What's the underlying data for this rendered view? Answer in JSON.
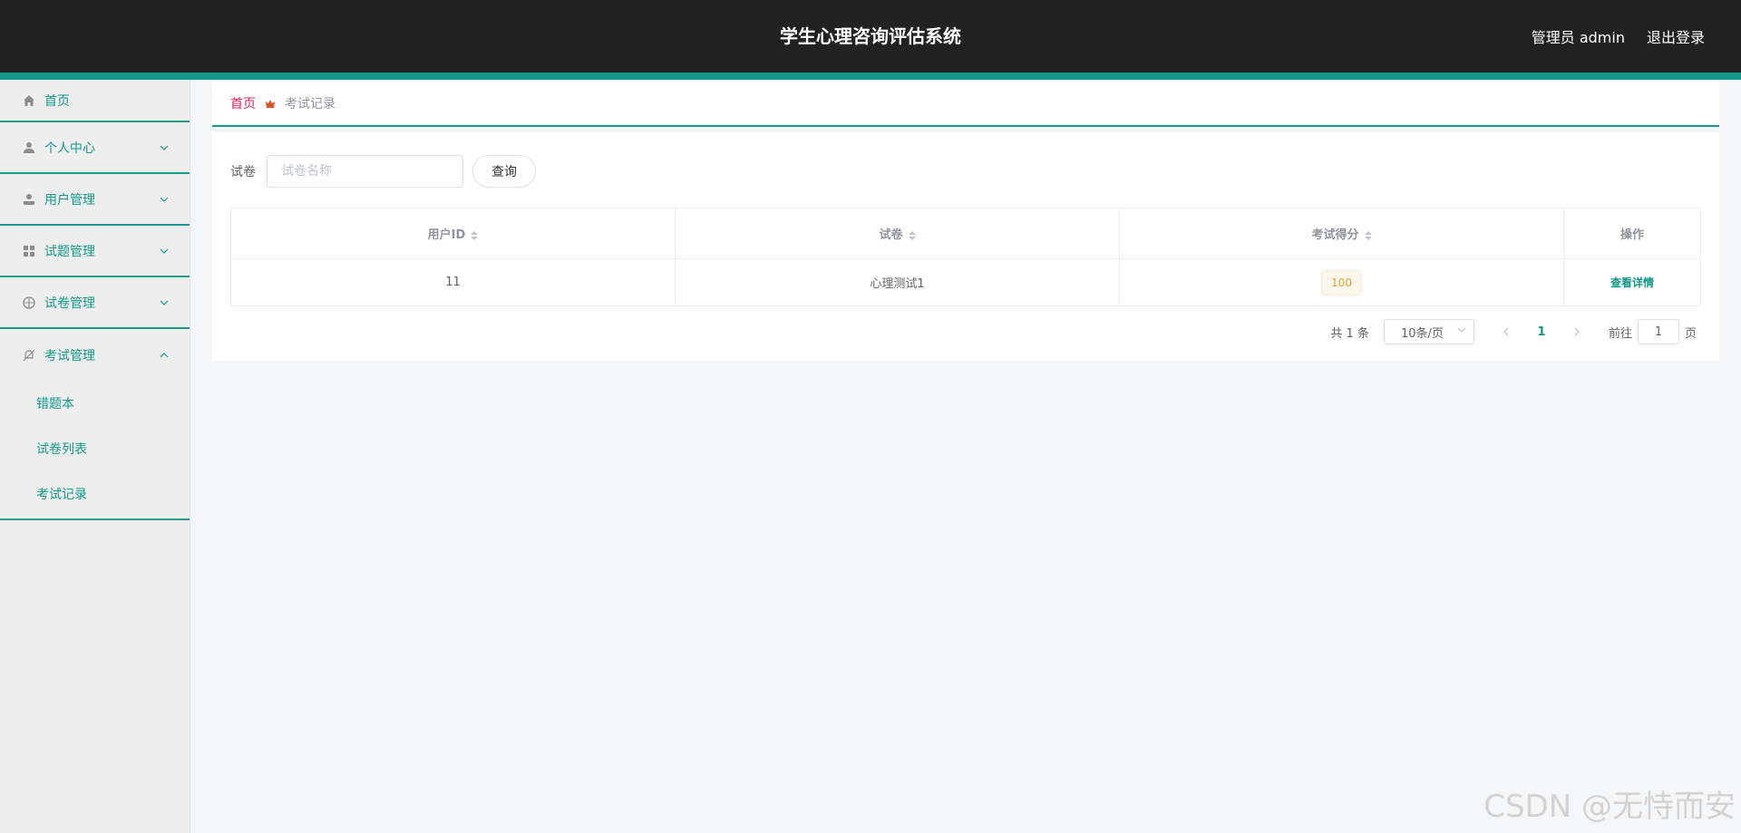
{
  "header": {
    "title": "学生心理咨询评估系统",
    "user_label": "管理员 admin",
    "logout_label": "退出登录"
  },
  "sidebar": {
    "items": [
      {
        "label": "首页",
        "icon": "home-icon"
      },
      {
        "label": "个人中心",
        "icon": "user-icon"
      },
      {
        "label": "用户管理",
        "icon": "user-manage-icon"
      },
      {
        "label": "试题管理",
        "icon": "grid-icon"
      },
      {
        "label": "试卷管理",
        "icon": "compass-icon"
      },
      {
        "label": "考试管理",
        "icon": "bell-off-icon"
      }
    ],
    "sub_items": [
      "错题本",
      "试卷列表",
      "考试记录"
    ]
  },
  "breadcrumb": {
    "home": "首页",
    "current": "考试记录"
  },
  "search": {
    "label": "试卷",
    "placeholder": "试卷名称",
    "button": "查询"
  },
  "table": {
    "headers": [
      "用户ID",
      "试卷",
      "考试得分",
      "操作"
    ],
    "rows": [
      {
        "user_id": "11",
        "paper": "心理测试1",
        "score": "100",
        "action": "查看详情"
      }
    ]
  },
  "pagination": {
    "total": "共 1 条",
    "page_size": "10条/页",
    "current_page": "1",
    "goto_label": "前往",
    "goto_value": "1",
    "page_suffix": "页"
  },
  "watermark": "CSDN @无恃而安",
  "colors": {
    "header_bg": "#222222",
    "accent": "#13988a",
    "breadcrumb_home": "#e0245e",
    "score_tag": "#e6a23c"
  }
}
